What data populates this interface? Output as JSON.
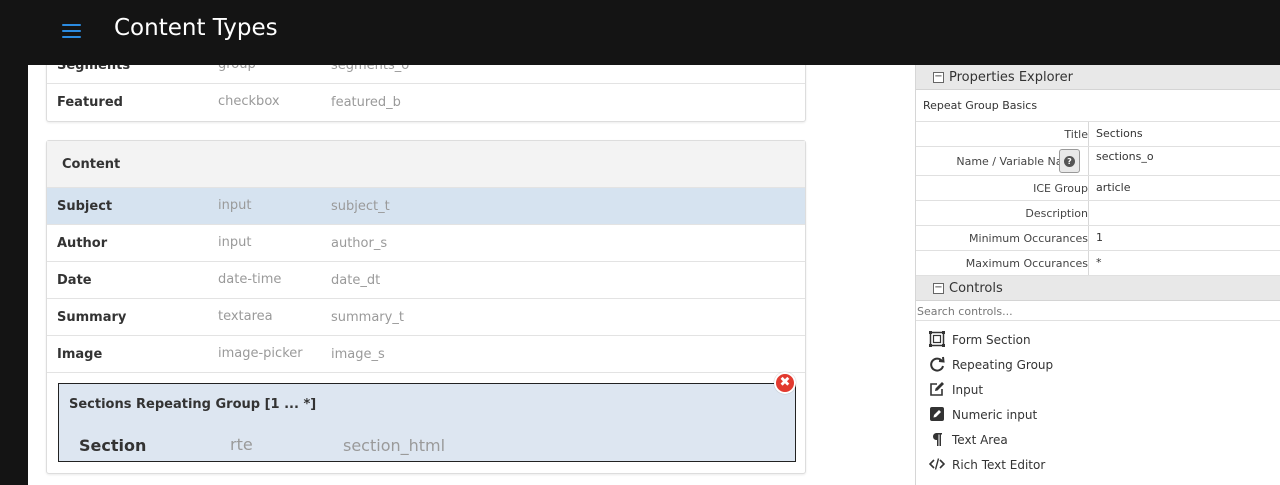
{
  "header": {
    "title": "Content Types",
    "menu_icon": "hamburger-menu-icon",
    "accent": "#2b8be0"
  },
  "top_section": {
    "fields": [
      {
        "name": "Segments",
        "type": "group",
        "variable": "segments_o"
      },
      {
        "name": "Featured",
        "type": "checkbox",
        "variable": "featured_b"
      }
    ]
  },
  "content_section": {
    "title": "Content",
    "fields": [
      {
        "name": "Subject",
        "type": "input",
        "variable": "subject_t",
        "selected": true
      },
      {
        "name": "Author",
        "type": "input",
        "variable": "author_s"
      },
      {
        "name": "Date",
        "type": "date-time",
        "variable": "date_dt"
      },
      {
        "name": "Summary",
        "type": "textarea",
        "variable": "summary_t"
      },
      {
        "name": "Image",
        "type": "image-picker",
        "variable": "image_s"
      }
    ],
    "repeat_group": {
      "title": "Sections Repeating Group [1 ... *]",
      "field": {
        "name": "Section",
        "type": "rte",
        "variable": "section_html"
      }
    }
  },
  "properties_explorer": {
    "title": "Properties Explorer",
    "group_label": "Repeat Group Basics",
    "rows": [
      {
        "label": "Title",
        "value": "Sections"
      },
      {
        "label": "Name / Variable Name",
        "value": "sections_o"
      },
      {
        "label": "ICE Group",
        "value": "article"
      },
      {
        "label": "Description",
        "value": ""
      },
      {
        "label": "Minimum Occurances",
        "value": "1"
      },
      {
        "label": "Maximum Occurances",
        "value": "*"
      }
    ]
  },
  "controls": {
    "title": "Controls",
    "search_placeholder": "Search controls...",
    "items": [
      {
        "label": "Form Section",
        "icon": "form-section-icon"
      },
      {
        "label": "Repeating Group",
        "icon": "repeat-icon"
      },
      {
        "label": "Input",
        "icon": "edit-icon"
      },
      {
        "label": "Numeric input",
        "icon": "pencil-square-icon"
      },
      {
        "label": "Text Area",
        "icon": "paragraph-icon"
      },
      {
        "label": "Rich Text Editor",
        "icon": "code-icon"
      }
    ]
  },
  "colors": {
    "selected_row": "#d6e3f0",
    "delete": "#e23a2f",
    "topbar": "#141414"
  }
}
